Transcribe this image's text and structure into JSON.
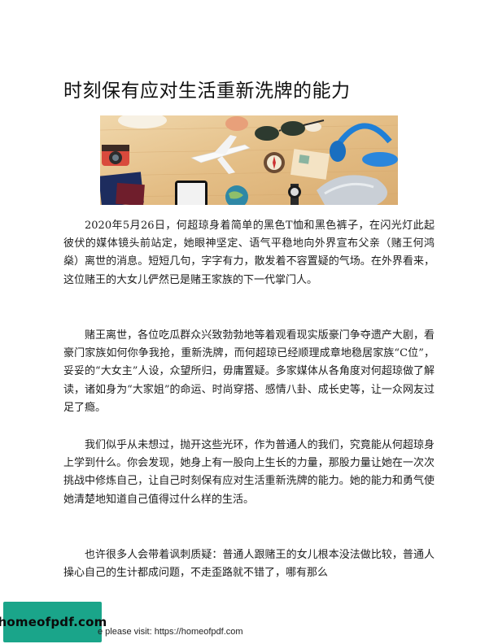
{
  "document": {
    "title": "时刻保有应对生活重新洗牌的能力",
    "image": {
      "icons": [
        "sunglasses-icon",
        "airplane-icon",
        "camera-icon",
        "passport-icon",
        "smartphone-icon",
        "headphones-icon",
        "wristwatch-icon",
        "compass-icon",
        "seashell-icon",
        "globe-icon"
      ]
    },
    "paragraphs": [
      "2020年5月26日，何超琼身着简单的黑色T恤和黑色裤子，在闪光灯此起彼伏的媒体镜头前站定，她眼神坚定、语气平稳地向外界宣布父亲（赌王何鸿燊）离世的消息。短短几句，字字有力，散发着不容置疑的气场。在外界看来，这位赌王的大女儿俨然已是赌王家族的下一代掌门人。",
      "赌王离世，各位吃瓜群众兴致勃勃地等着观看现实版豪门争夺遗产大剧，看豪门家族如何你争我抢，重新洗牌，而何超琼已经顺理成章地稳居家族“C位”，妥妥的“大女主”人设，众望所归，毋庸置疑。多家媒体从各角度对何超琼做了解读，诸如身为“大家姐”的命运、时尚穿搭、感情八卦、成长史等，让一众网友过足了瘾。",
      "我们似乎从未想过，抛开这些光环，作为普通人的我们，究竟能从何超琼身上学到什么。你会发现，她身上有一股向上生长的力量，那股力量让她在一次次挑战中修炼自己，让自己时刻保有应对生活重新洗牌的能力。她的能力和勇气使她清楚地知道自己值得过什么样的生活。",
      "也许很多人会带着讽刺质疑：普通人跟赌王的女儿根本没法做比较，普通人操心自己的生计都成问题，不走歪路就不错了，哪有那么"
    ]
  },
  "watermark": {
    "badge_text": "homeofpdf.com",
    "footer_text": "e please visit: https://homeofpdf.com"
  },
  "colors": {
    "badge": "#1aa58a",
    "hero_background": "#e6c79a"
  }
}
